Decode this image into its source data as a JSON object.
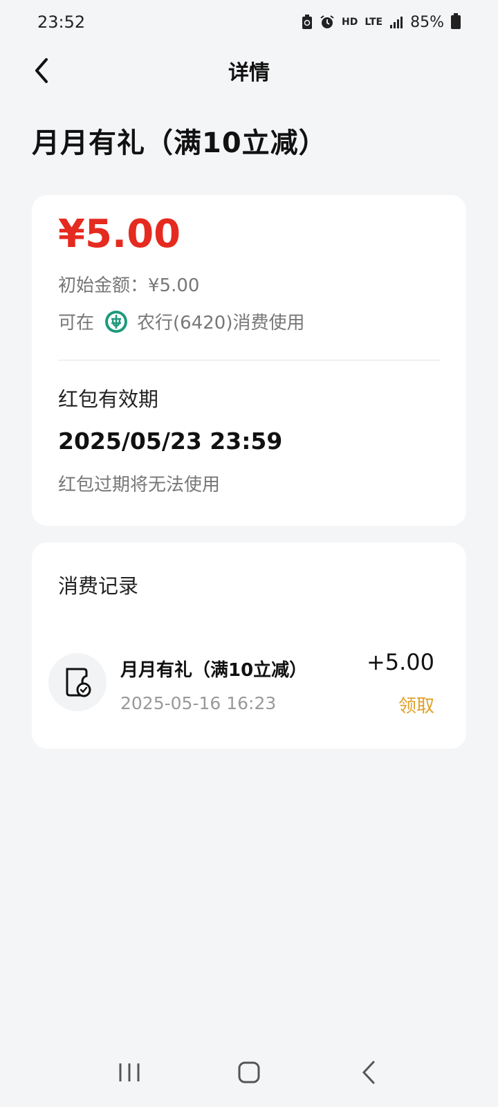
{
  "status_bar": {
    "time": "23:52",
    "network_hd": "HD",
    "network_lte": "LTE",
    "battery": "85%"
  },
  "header": {
    "title": "详情"
  },
  "page_title": "月月有礼（满10立减）",
  "summary_card": {
    "amount": "¥5.00",
    "amount_color": "#e52a1f",
    "initial_amount": "初始金额：¥5.00",
    "usable_prefix": "可在",
    "usable_bank": "农行(6420)消费使用",
    "validity_label": "红包有效期",
    "validity_date": "2025/05/23 23:59",
    "validity_note": "红包过期将无法使用"
  },
  "records_card": {
    "title": "消费记录",
    "items": [
      {
        "name": "月月有礼（满10立减）",
        "time": "2025-05-16 16:23",
        "amount": "+5.00",
        "status": "领取",
        "status_color": "#e0a12a",
        "icon": "coupon-check-icon"
      }
    ]
  }
}
